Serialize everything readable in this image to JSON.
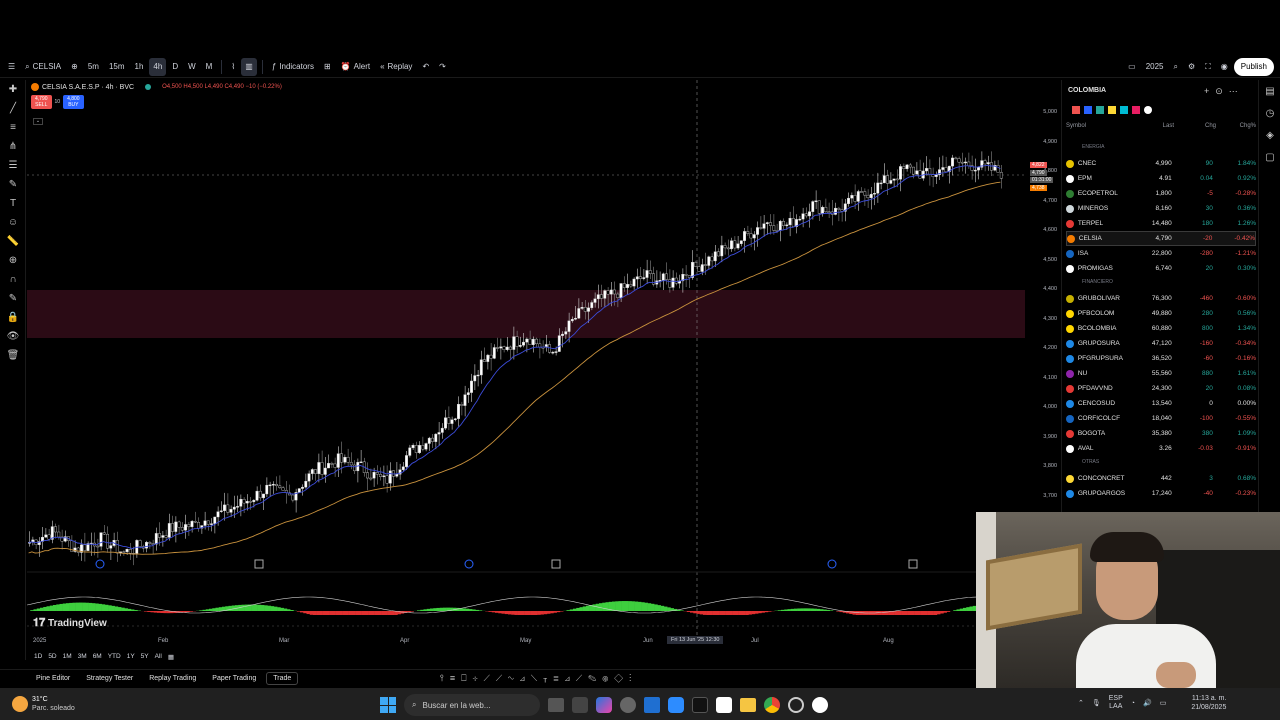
{
  "toolbar": {
    "symbol": "CELSIA",
    "intervals": [
      "5m",
      "15m",
      "1h",
      "4h",
      "D",
      "W",
      "M"
    ],
    "active_interval": "4h",
    "indicators": "Indicators",
    "alert": "Alert",
    "replay": "Replay",
    "year": "2025",
    "publish": "Publish"
  },
  "legend": {
    "title": "CELSIA S.A.E.S.P · 4h · BVC",
    "ohlc": "O4,500 H4,500 L4,490 C4,490 −10 (−0.22%)",
    "sell_price": "4,790",
    "sell_label": "SELL",
    "spread": "10",
    "buy_price": "4,800",
    "buy_label": "BUY"
  },
  "price_axis": {
    "ticks": [
      "5,000",
      "4,900",
      "4,800",
      "4,700",
      "4,600",
      "4,500",
      "4,400",
      "4,300",
      "4,200",
      "4,100",
      "4,000",
      "3,900",
      "3,800",
      "3,700"
    ],
    "current_label": "CELSIA",
    "current_price": "4,790",
    "countdown": "01:31:00",
    "high_tag": "4,822",
    "low_tag": "4,738"
  },
  "time_axis": {
    "labels": [
      "2025",
      "Feb",
      "Mar",
      "Apr",
      "May",
      "Jun",
      "Jul",
      "Aug"
    ],
    "crosshair": "Fri 13 Jun '25  12:30"
  },
  "branding": "TradingView",
  "ranges": [
    "1D",
    "5D",
    "1M",
    "3M",
    "6M",
    "YTD",
    "1Y",
    "5Y",
    "All"
  ],
  "bottom_tabs": [
    "Pine Editor",
    "Strategy Tester",
    "Replay Trading",
    "Paper Trading",
    "Trade"
  ],
  "watchlist": {
    "title": "COLOMBIA",
    "headers": [
      "Symbol",
      "Last",
      "Chg",
      "Chg%"
    ],
    "sections": [
      {
        "name": "ENERGIA",
        "rows": [
          {
            "sym": "CNEC",
            "last": "4,990",
            "chg": "90",
            "chgp": "1.84%",
            "dir": "up",
            "color": "#e6c200"
          },
          {
            "sym": "EPM",
            "last": "4.91",
            "chg": "0.04",
            "chgp": "0.92%",
            "dir": "up",
            "color": "#ffffff"
          },
          {
            "sym": "ECOPETROL",
            "last": "1,800",
            "chg": "-5",
            "chgp": "-0.28%",
            "dir": "down",
            "color": "#2e7d32"
          },
          {
            "sym": "MINEROS",
            "last": "8,160",
            "chg": "30",
            "chgp": "0.36%",
            "dir": "up",
            "color": "#cfd8dc"
          },
          {
            "sym": "TERPEL",
            "last": "14,480",
            "chg": "180",
            "chgp": "1.26%",
            "dir": "up",
            "color": "#e53935"
          },
          {
            "sym": "CELSIA",
            "last": "4,790",
            "chg": "-20",
            "chgp": "-0.42%",
            "dir": "down",
            "color": "#f57c00"
          },
          {
            "sym": "ISA",
            "last": "22,800",
            "chg": "-280",
            "chgp": "-1.21%",
            "dir": "down",
            "color": "#1565c0"
          },
          {
            "sym": "PROMIGAS",
            "last": "6,740",
            "chg": "20",
            "chgp": "0.30%",
            "dir": "up",
            "color": "#ffffff"
          }
        ]
      },
      {
        "name": "FINANCIERO",
        "rows": [
          {
            "sym": "GRUBOLIVAR",
            "last": "76,300",
            "chg": "-460",
            "chgp": "-0.60%",
            "dir": "down",
            "color": "#c6b000"
          },
          {
            "sym": "PFBCOLOM",
            "last": "49,880",
            "chg": "280",
            "chgp": "0.56%",
            "dir": "up",
            "color": "#ffd600"
          },
          {
            "sym": "BCOLOMBIA",
            "last": "60,880",
            "chg": "800",
            "chgp": "1.34%",
            "dir": "up",
            "color": "#ffd600"
          },
          {
            "sym": "GRUPOSURA",
            "last": "47,120",
            "chg": "-160",
            "chgp": "-0.34%",
            "dir": "down",
            "color": "#1e88e5"
          },
          {
            "sym": "PFGRUPSURA",
            "last": "36,520",
            "chg": "-60",
            "chgp": "-0.16%",
            "dir": "down",
            "color": "#1e88e5"
          },
          {
            "sym": "NU",
            "last": "55,560",
            "chg": "880",
            "chgp": "1.61%",
            "dir": "up",
            "color": "#8e24aa"
          },
          {
            "sym": "PFDAVVND",
            "last": "24,300",
            "chg": "20",
            "chgp": "0.08%",
            "dir": "up",
            "color": "#e53935"
          },
          {
            "sym": "CENCOSUD",
            "last": "13,540",
            "chg": "0",
            "chgp": "0.00%",
            "dir": "flat",
            "color": "#1e88e5"
          },
          {
            "sym": "CORFICOLCF",
            "last": "18,040",
            "chg": "-100",
            "chgp": "-0.55%",
            "dir": "down",
            "color": "#1565c0"
          },
          {
            "sym": "BOGOTA",
            "last": "35,380",
            "chg": "380",
            "chgp": "1.09%",
            "dir": "up",
            "color": "#e53935"
          },
          {
            "sym": "AVAL",
            "last": "3.26",
            "chg": "-0.03",
            "chgp": "-0.91%",
            "dir": "down",
            "color": "#ffffff"
          }
        ]
      },
      {
        "name": "OTRAS",
        "rows": [
          {
            "sym": "CONCONCRET",
            "last": "442",
            "chg": "3",
            "chgp": "0.68%",
            "dir": "up",
            "color": "#fdd835"
          },
          {
            "sym": "GRUPOARGOS",
            "last": "17,240",
            "chg": "-40",
            "chgp": "-0.23%",
            "dir": "down",
            "color": "#1e88e5"
          }
        ]
      }
    ]
  },
  "taskbar": {
    "temp": "31°C",
    "weather": "Parc. soleado",
    "search_placeholder": "Buscar en la web...",
    "lang1": "ESP",
    "lang2": "LAA",
    "time": "11:13 a. m.",
    "date": "21/08/2025"
  },
  "colors": {
    "up": "#26a69a",
    "down": "#ef5350",
    "accent": "#2962ff"
  },
  "chart_data": {
    "type": "candlestick",
    "symbol": "CELSIA S.A.E.S.P",
    "interval": "4h",
    "ylim": [
      3700,
      5050
    ],
    "x_labels": [
      "Feb",
      "Mar",
      "Apr",
      "May",
      "Jun",
      "Jul",
      "Aug"
    ],
    "approx_close_path": [
      3750,
      3780,
      3730,
      3760,
      3720,
      3750,
      3790,
      3800,
      3830,
      3860,
      3900,
      3880,
      3950,
      3980,
      3960,
      3920,
      4000,
      4050,
      4120,
      4250,
      4300,
      4330,
      4280,
      4380,
      4430,
      4460,
      4500,
      4480,
      4520,
      4560,
      4600,
      4650,
      4640,
      4700,
      4680,
      4720,
      4760,
      4800,
      4780,
      4820,
      4810,
      4790
    ],
    "overlays": [
      "EMA fast",
      "SMA slow"
    ],
    "shaded_zone": [
      4240,
      4410
    ]
  }
}
